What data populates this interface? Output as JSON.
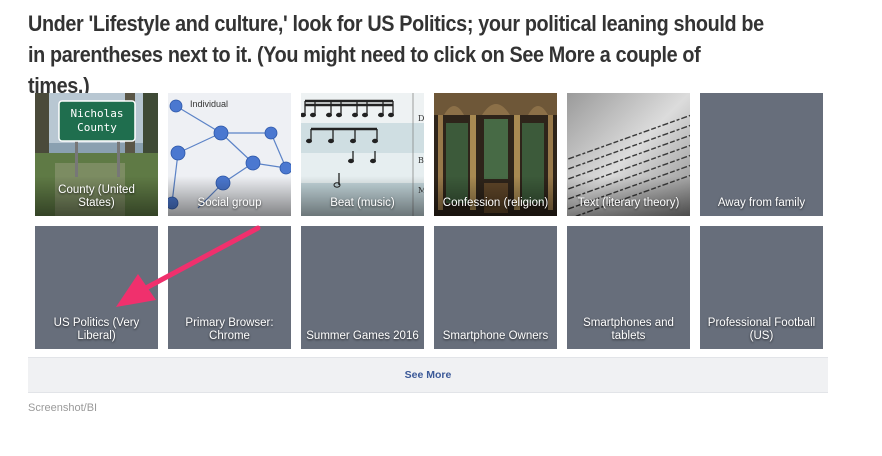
{
  "instruction": "Under 'Lifestyle and culture,' look for US Politics; your political leaning should be in parentheses next to it. (You might need to click on See More a couple of times.)",
  "tiles_row1": [
    {
      "label": "County (United States)",
      "image_text": "Nicholas County"
    },
    {
      "label": "Social group",
      "image_text": "Individual"
    },
    {
      "label": "Beat (music)"
    },
    {
      "label": "Confession (religion)"
    },
    {
      "label": "Text (literary theory)"
    },
    {
      "label": "Away from family"
    }
  ],
  "tiles_row2": [
    {
      "label": "US Politics (Very Liberal)"
    },
    {
      "label": "Primary Browser: Chrome"
    },
    {
      "label": "Summer Games 2016"
    },
    {
      "label": "Smartphone Owners"
    },
    {
      "label": "Smartphones and tablets"
    },
    {
      "label": "Professional Football (US)"
    }
  ],
  "see_more": "See More",
  "credit": "Screenshot/BI",
  "colors": {
    "tile": "#676e7b",
    "arrow": "#f0306d",
    "link": "#3b5998"
  }
}
